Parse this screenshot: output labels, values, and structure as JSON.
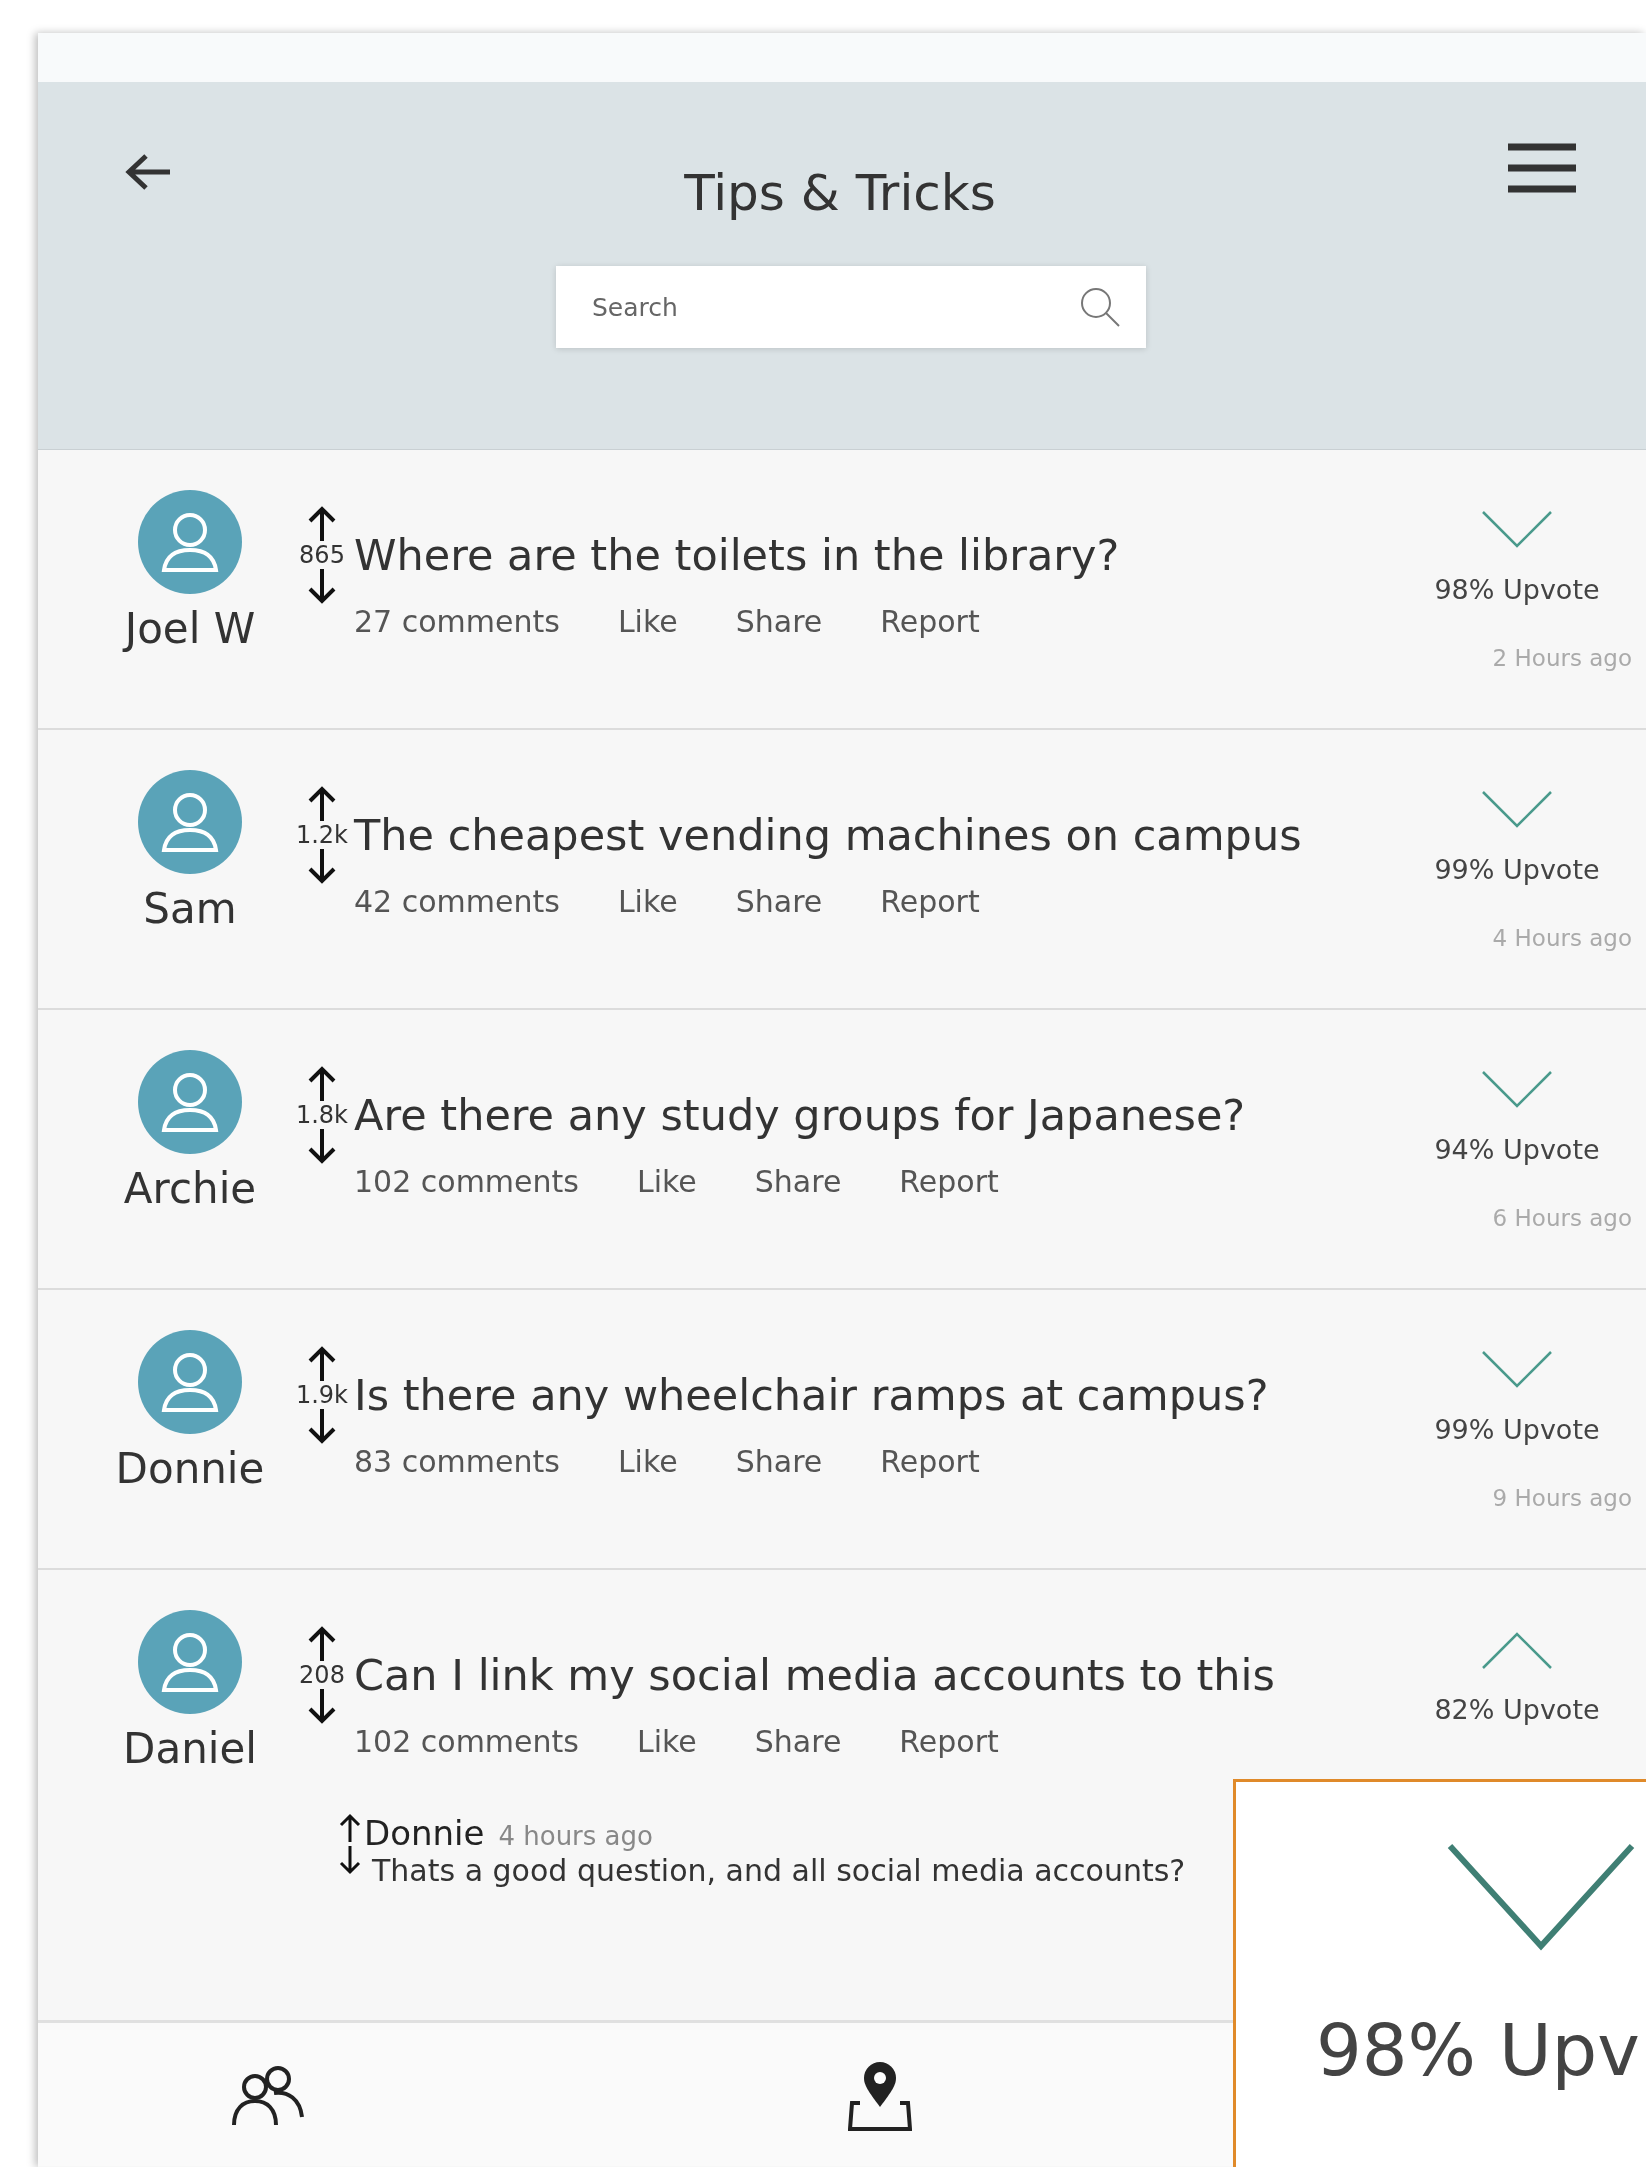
{
  "header": {
    "title": "Tips & Tricks",
    "search": {
      "placeholder": "Search"
    }
  },
  "posts": [
    {
      "author": "Joel W",
      "votes": "865",
      "title": "Where are the toilets in the library?",
      "comments": "27 comments",
      "actions": [
        "Like",
        "Share",
        "Report"
      ],
      "upvote": "98% Upvote",
      "time": "2 Hours ago",
      "expanded": false
    },
    {
      "author": "Sam",
      "votes": "1.2k",
      "title": "The cheapest vending machines on campus",
      "comments": "42 comments",
      "actions": [
        "Like",
        "Share",
        "Report"
      ],
      "upvote": "99% Upvote",
      "time": "4 Hours ago",
      "expanded": false
    },
    {
      "author": "Archie",
      "votes": "1.8k",
      "title": "Are there any study groups for Japanese?",
      "comments": "102 comments",
      "actions": [
        "Like",
        "Share",
        "Report"
      ],
      "upvote": "94% Upvote",
      "time": "6 Hours ago",
      "expanded": false
    },
    {
      "author": "Donnie",
      "votes": "1.9k",
      "title": "Is there any wheelchair ramps at campus?",
      "comments": "83 comments",
      "actions": [
        "Like",
        "Share",
        "Report"
      ],
      "upvote": "99% Upvote",
      "time": "9 Hours ago",
      "expanded": false
    },
    {
      "author": "Daniel",
      "votes": "208",
      "title": "Can I link my social media accounts to this",
      "comments": "102 comments",
      "actions": [
        "Like",
        "Share",
        "Report"
      ],
      "upvote": "82% Upvote",
      "expanded": true,
      "replies": [
        {
          "author": "Donnie",
          "time": "4 hours ago",
          "text": "Thats a good question, and all social media accounts?"
        }
      ]
    }
  ],
  "zoom_inset": {
    "text": "98% Upv"
  }
}
